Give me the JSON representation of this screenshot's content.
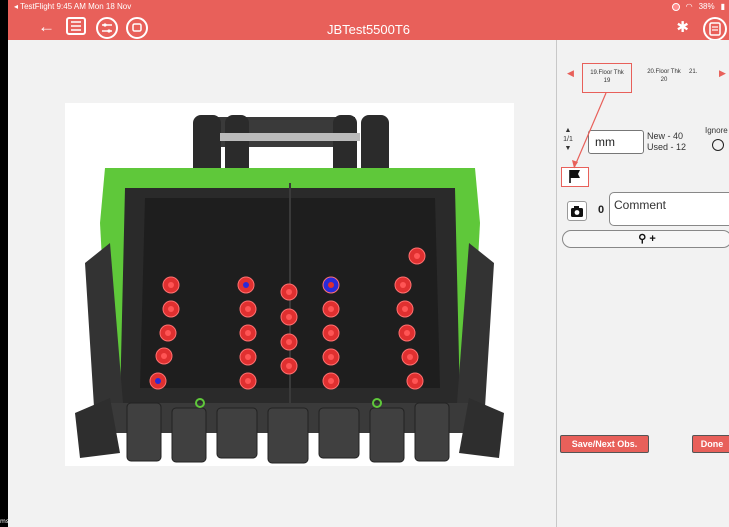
{
  "status": {
    "left": "◂ TestFlight  9:45 AM  Mon 18 Nov",
    "battery": "38%"
  },
  "header": {
    "title": "JBTest5500T6",
    "icons": [
      "back-icon",
      "list-icon",
      "filter-icon",
      "chat-icon",
      "bluetooth-icon",
      "notes-icon"
    ]
  },
  "corner_text": "ms",
  "panel": {
    "tabs": [
      {
        "line1": "19.Floor Thk",
        "line2": "19"
      },
      {
        "line1": "20.Floor Thk",
        "line2": "20"
      },
      {
        "line1": "21.",
        "line2": ""
      }
    ],
    "stepper": "1/1",
    "unit": "mm",
    "new_label": "New  - 40",
    "used_label": "Used - 12",
    "ignore_label": "Ignore",
    "photo_count": "0",
    "comment_placeholder": "Comment",
    "location_label": "+",
    "save_label": "Save/Next Obs.",
    "done_label": "Done"
  },
  "colors": {
    "accent": "#e8605a",
    "measure_point": "#e03030",
    "selected_point": "#2a2ad8",
    "bucket_green": "#5fc83a"
  }
}
